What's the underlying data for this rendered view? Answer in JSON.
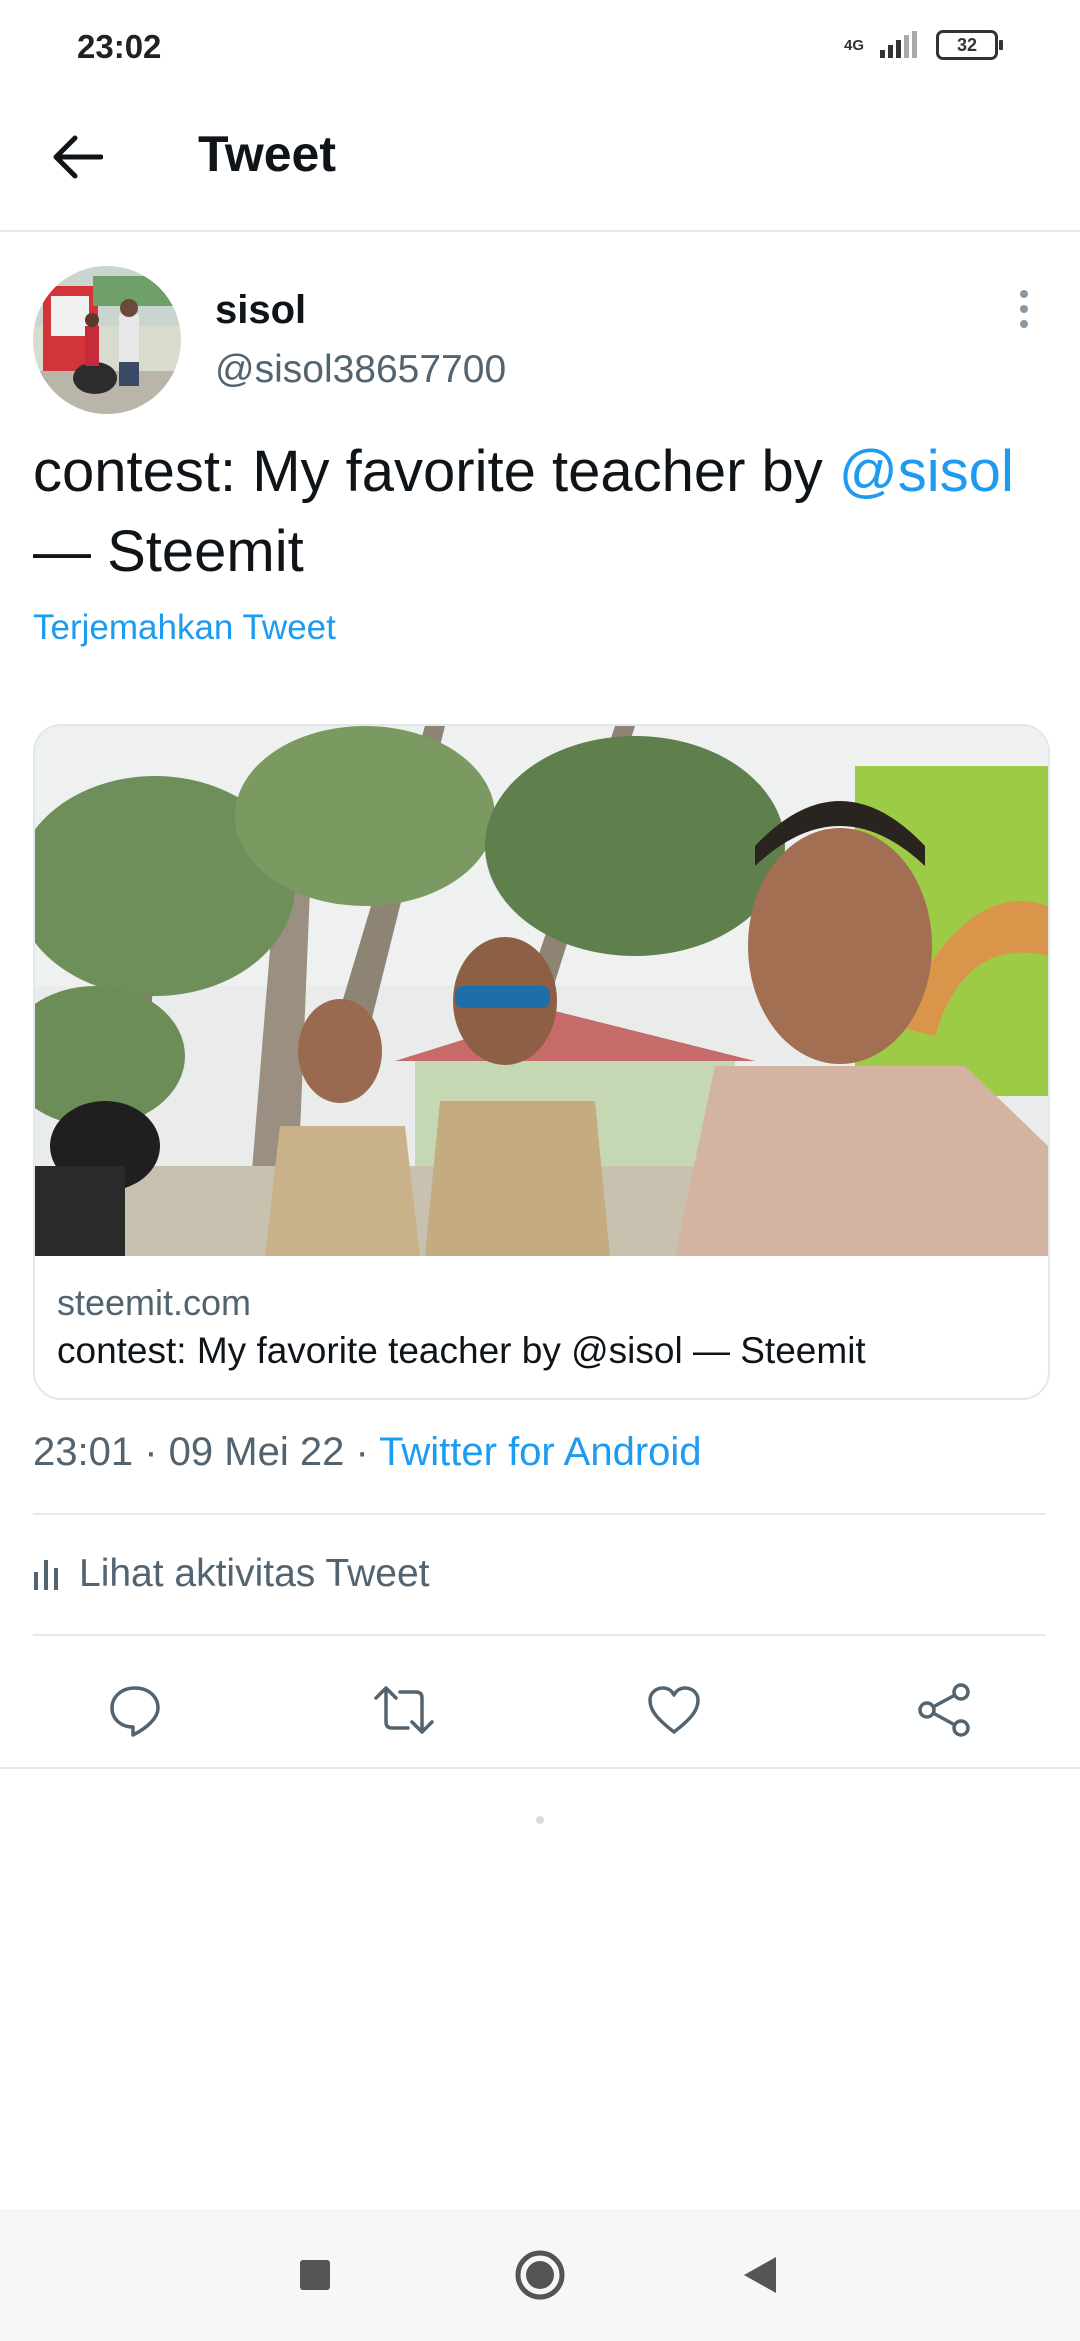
{
  "status_bar": {
    "time": "23:02",
    "network": "4G",
    "battery": "32"
  },
  "header": {
    "title": "Tweet"
  },
  "author": {
    "name": "sisol",
    "handle": "@sisol38657700"
  },
  "tweet": {
    "text_before": "contest: My favorite teacher by ",
    "mention": "@sisol",
    "text_after": " — Steemit",
    "translate_label": "Terjemahkan Tweet"
  },
  "card": {
    "domain": "steemit.com",
    "title": "contest: My favorite teacher by @sisol — Steemit"
  },
  "meta": {
    "time": "23:01",
    "separator": " · ",
    "date": "09 Mei 22",
    "source": "Twitter for Android"
  },
  "activity": {
    "label": "Lihat aktivitas Tweet"
  },
  "actions": [
    "reply-icon",
    "retweet-icon",
    "like-icon",
    "share-icon"
  ],
  "colors": {
    "accent": "#1d9bf0",
    "secondary_text": "#536471",
    "divider": "#e6e9ec"
  }
}
